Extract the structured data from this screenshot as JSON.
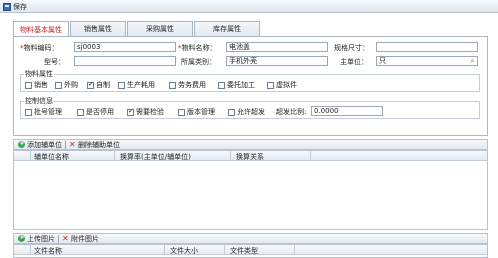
{
  "toolbar": {
    "save_label": "保存"
  },
  "tabs": [
    {
      "label": "物料基本属性"
    },
    {
      "label": "销售属性"
    },
    {
      "label": "采购属性"
    },
    {
      "label": "库存属性"
    }
  ],
  "form": {
    "code_label": "物料编码：",
    "code_value": "sj0003",
    "name_label": "物料名称：",
    "name_value": "电池盖",
    "spec_label": "规格尺寸：",
    "spec_value": "",
    "model_label": "型号：",
    "model_value": "",
    "category_label": "所属类别：",
    "category_value": "手机外壳",
    "unit_label": "主单位：",
    "unit_value": "只",
    "required_mark": "*"
  },
  "attributes": {
    "title": "物料属性",
    "items": [
      {
        "label": "销售",
        "checked": false
      },
      {
        "label": "外购",
        "checked": false
      },
      {
        "label": "自制",
        "checked": true
      },
      {
        "label": "生产耗用",
        "checked": false
      },
      {
        "label": "劳务费用",
        "checked": false
      },
      {
        "label": "委托加工",
        "checked": false
      },
      {
        "label": "虚拟件",
        "checked": false
      }
    ]
  },
  "control": {
    "title": "控制信息",
    "items": [
      {
        "label": "批号管理",
        "checked": false
      },
      {
        "label": "是否停用",
        "checked": false
      },
      {
        "label": "需要检验",
        "checked": true
      },
      {
        "label": "版本管理",
        "checked": false
      },
      {
        "label": "允许超发",
        "checked": false
      }
    ],
    "overissue_label": "超发比例:",
    "overissue_value": "0.0000"
  },
  "aux_unit": {
    "add_label": "添加辅单位",
    "delete_label": "删除辅助单位",
    "columns": [
      "辅单位名称",
      "换算率(主单位/辅单位)",
      "换算关系"
    ]
  },
  "images": {
    "upload_label": "上传图片",
    "attach_label": "附件图片",
    "columns": [
      "文件名称",
      "文件大小",
      "文件类型"
    ]
  },
  "colors": {
    "active_tab": "#c21f1f",
    "required": "#dd0000",
    "toolbar_bg": "#dfe6ee",
    "border": "#a9b7c7"
  },
  "icons": [
    "save-icon",
    "add-icon",
    "delete-icon",
    "picture-icon",
    "lookup-icon",
    "checkbox-icon"
  ]
}
